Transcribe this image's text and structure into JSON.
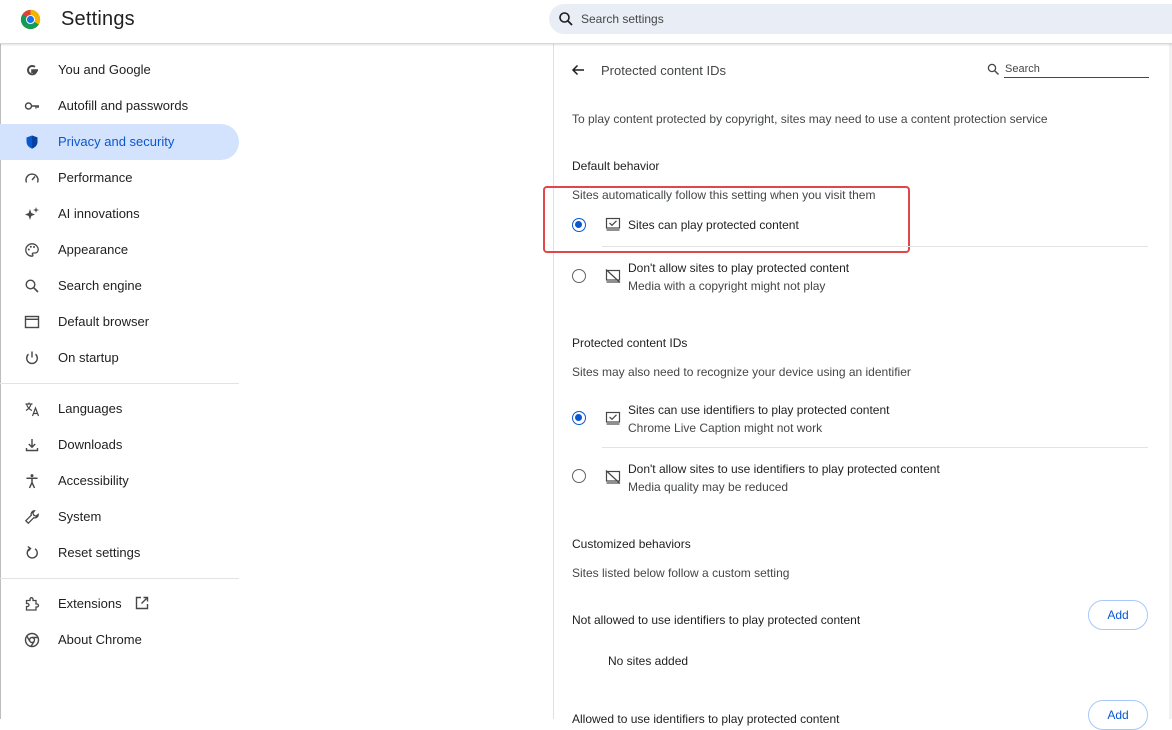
{
  "header": {
    "title": "Settings",
    "search_placeholder": "Search settings"
  },
  "sidebar": {
    "items": [
      {
        "label": "You and Google",
        "icon": "google-g-icon"
      },
      {
        "label": "Autofill and passwords",
        "icon": "key-icon"
      },
      {
        "label": "Privacy and security",
        "icon": "shield-icon",
        "active": true
      },
      {
        "label": "Performance",
        "icon": "speedometer-icon"
      },
      {
        "label": "AI innovations",
        "icon": "sparkle-icon"
      },
      {
        "label": "Appearance",
        "icon": "palette-icon"
      },
      {
        "label": "Search engine",
        "icon": "search-icon"
      },
      {
        "label": "Default browser",
        "icon": "browser-window-icon"
      },
      {
        "label": "On startup",
        "icon": "power-icon"
      },
      {
        "label": "Languages",
        "icon": "translate-icon"
      },
      {
        "label": "Downloads",
        "icon": "download-icon"
      },
      {
        "label": "Accessibility",
        "icon": "accessibility-icon"
      },
      {
        "label": "System",
        "icon": "wrench-icon"
      },
      {
        "label": "Reset settings",
        "icon": "reset-icon"
      },
      {
        "label": "Extensions",
        "icon": "puzzle-icon"
      },
      {
        "label": "About Chrome",
        "icon": "chrome-icon"
      }
    ]
  },
  "page": {
    "title": "Protected content IDs",
    "search_placeholder": "Search",
    "description": "To play content protected by copyright, sites may need to use a content protection service",
    "default_behavior": {
      "heading": "Default behavior",
      "subtitle": "Sites automatically follow this setting when you visit them",
      "options": [
        {
          "label": "Sites can play protected content",
          "sub": "",
          "checked": true
        },
        {
          "label": "Don't allow sites to play protected content",
          "sub": "Media with a copyright might not play",
          "checked": false
        }
      ]
    },
    "protected_ids": {
      "heading": "Protected content IDs",
      "subtitle": "Sites may also need to recognize your device using an identifier",
      "options": [
        {
          "label": "Sites can use identifiers to play protected content",
          "sub": "Chrome Live Caption might not work",
          "checked": true
        },
        {
          "label": "Don't allow sites to use identifiers to play protected content",
          "sub": "Media quality may be reduced",
          "checked": false
        }
      ]
    },
    "customized": {
      "heading": "Customized behaviors",
      "subtitle": "Sites listed below follow a custom setting",
      "not_allowed_label": "Not allowed to use identifiers to play protected content",
      "add_label": "Add",
      "empty_label": "No sites added",
      "allowed_label": "Allowed to use identifiers to play protected content",
      "add_label_2": "Add"
    }
  },
  "colors": {
    "accent": "#0b57d0",
    "active_bg": "#d3e3fd",
    "highlight": "#e0464a"
  }
}
